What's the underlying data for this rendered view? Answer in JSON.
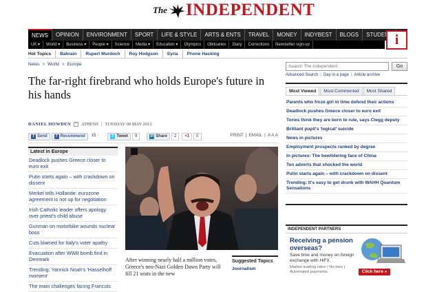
{
  "brand": {
    "the": "The",
    "name": "INDEPENDENT",
    "i_logo": "i",
    "logo_color": "#c4161c"
  },
  "nav": [
    "NEWS",
    "OPINION",
    "ENVIRONMENT",
    "SPORT",
    "LIFE & STYLE",
    "ARTS & ENTS",
    "TRAVEL",
    "MONEY",
    "INDYBEST",
    "BLOGS",
    "STUDENT"
  ],
  "subnav": [
    "UK ▾",
    "World ▾",
    "Business ▾",
    "People ▾",
    "Science",
    "Media ▾",
    "Education ▾",
    "Olympics",
    "Obituaries",
    "Diary",
    "Corrections",
    "Newsletter sign-up"
  ],
  "hot_topics": {
    "label": "Hot Topics",
    "items": [
      "Bahrain",
      "Rupert Murdoch",
      "Roy Hodgson",
      "Syria",
      "Phone Hacking"
    ]
  },
  "breadcrumb": [
    "News",
    ">",
    "World",
    ">",
    "Europe"
  ],
  "article": {
    "headline": "The far-right firebrand who holds Europe's future in his hands",
    "author": "DANIEL HOWDEN",
    "author_plus": "+",
    "location": "ATHENS",
    "date": "TUESDAY 08 MAY 2012",
    "caption": "After winning nearly half a million votes, Greece's neo-Nazi Golden Dawn Party will fill 21 seats in the new"
  },
  "share": {
    "send": "Send",
    "recommend": "Recommend",
    "recommend_count": "15",
    "tweet": "Tweet",
    "tweet_count": "9",
    "linkedin": "Share",
    "linkedin_count": "2",
    "gplus": "+1",
    "gplus_count": "0",
    "print": "PRINT",
    "email": "EMAIL",
    "text_size": "A A A"
  },
  "latest": {
    "title": "Latest in Europe",
    "items": [
      "Deadlock pushes Greece closer to euro exit",
      "Putin starts again – with crackdown on dissent",
      "Merkel tells Hollande: eurozone agreement is not up for negotiation",
      "Irish Catholic leader offers apology over priest's child abuse",
      "Gunman on motorbike wounds nuclear boss",
      "Cuts blamed for Italy's voter apathy",
      "Evacuation after WWII bomb find in Denmark",
      "Trending: Yannick Noah's 'Hasselhoff moment'",
      "The main challenges facing Francois"
    ]
  },
  "suggested": {
    "title": "Suggested Topics",
    "items": [
      "Journalism"
    ]
  },
  "search": {
    "placeholder": "Search The Independent",
    "go": "Go",
    "links": [
      "Advanced Search",
      "Day in a page",
      "Article archive"
    ]
  },
  "most_viewed": {
    "tabs": [
      "Most Viewed",
      "Most Commented",
      "Most Shared"
    ],
    "items": [
      "Parents who froze girl in time defend their actions",
      "Deadlock pushes Greece closer to euro exit",
      "Tories think they are born to rule, says Clegg deputy",
      "Brilliant pupil's 'logical' suicide",
      "News in pictures",
      "Employment prospects ranked by degree",
      "In pictures: The bewildering face of China",
      "Ten adverts that shocked the world",
      "Putin starts again – with crackdown on dissent",
      "Trending: It's easy to get drunk with WAHH Quantum Sensations"
    ]
  },
  "partners": {
    "title": "INDEPENDENT PARTNERS",
    "ad_headline": "Receiving a pension overseas?",
    "ad_body": "Save time and money on foreign exchange with HiFX",
    "ad_small": "Market leading rates | No fees | Automated payments",
    "ad_button": "Click here »"
  },
  "colors": {
    "accent": "#c4161c",
    "link": "#1a3d7c",
    "nav_bg": "#222222"
  }
}
